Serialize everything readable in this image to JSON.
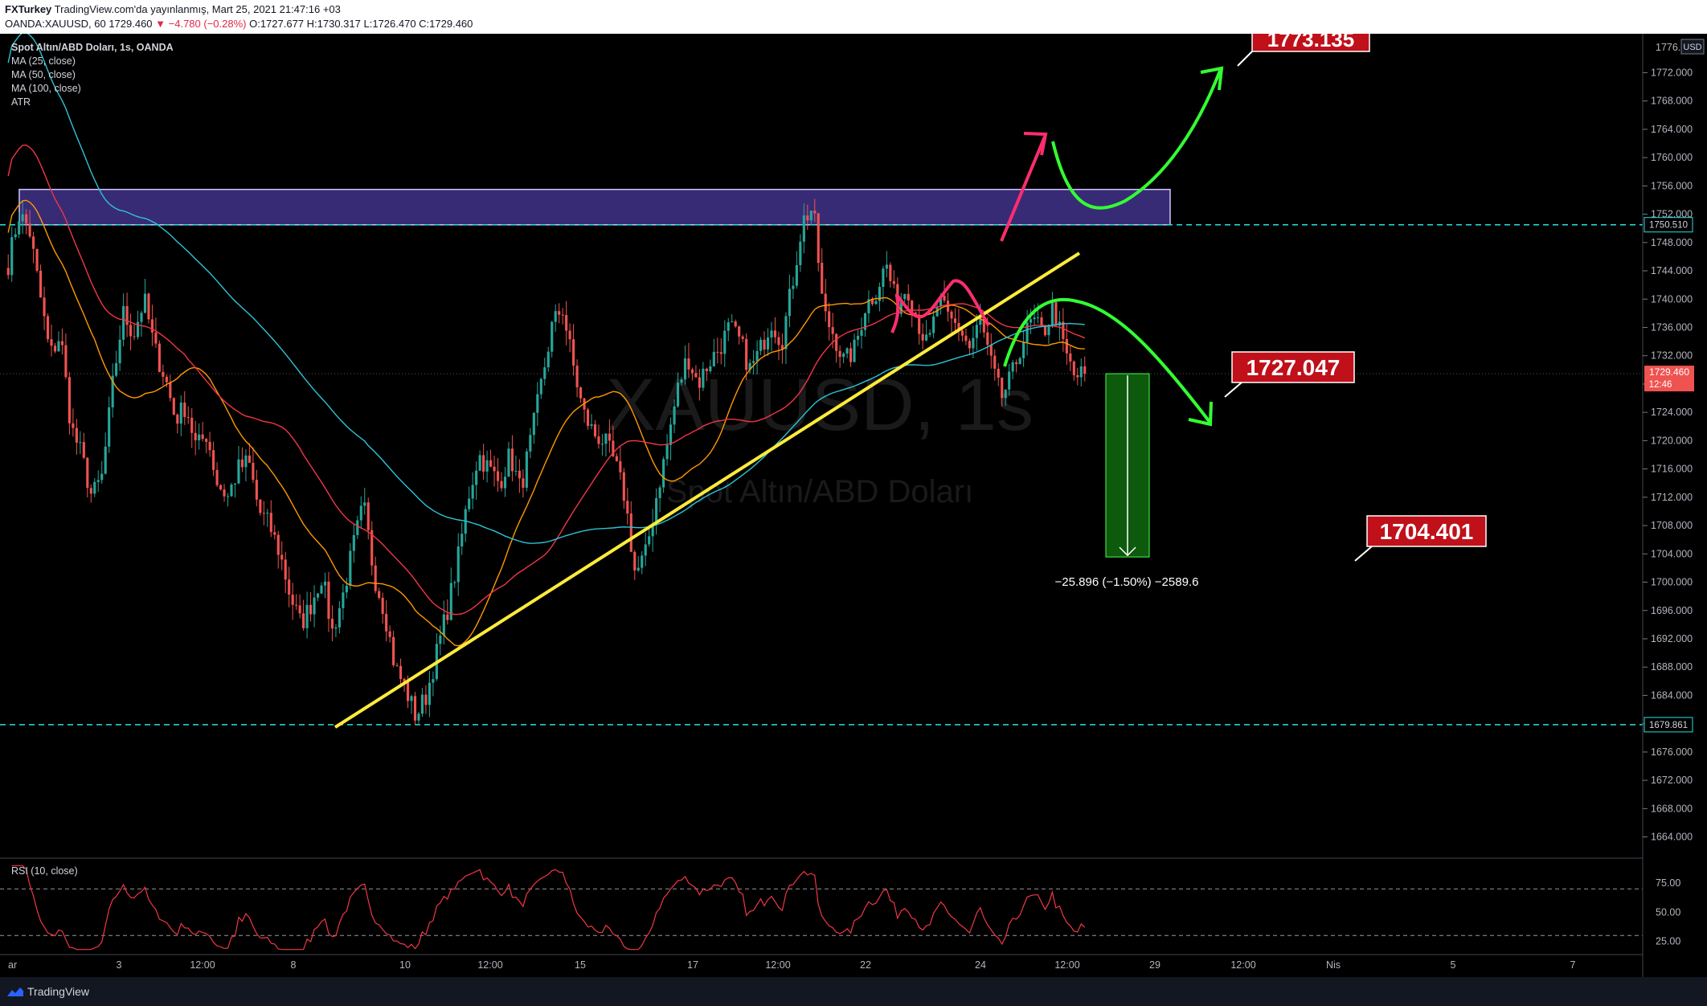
{
  "header": {
    "line1_user": "FXTurkey",
    "line1_rest": " TradingView.com'da yayınlanmış, Mart 25, 2021 21:47:16 +03",
    "line2_pre": "OANDA:XAUUSD, 60  1729.460 ",
    "line2_change": "▼ −4.780 (−0.28%)",
    "line2_ohlc": " O:1727.677  H:1730.317  L:1726.470  C:1729.460"
  },
  "legend": {
    "symbol": "Spot Altın/ABD Doları, 1s, OANDA",
    "ma25": "MA (25, close)",
    "ma50": "MA (50, close)",
    "ma100": "MA (100, close)",
    "atr": "ATR",
    "rsi": "RSI (10, close)"
  },
  "watermark": {
    "ticker": "XAUUSD, 1s",
    "name": "Spot Altın/ABD Doları"
  },
  "currency": "USD",
  "labels": {
    "target_up": "1773.135",
    "target_mid": "1727.047",
    "target_down": "1704.401",
    "measure": "−25.896 (−1.50%) −2589.6",
    "last_price": "1729.460",
    "countdown": "12:46",
    "resistance_price": "1750.510",
    "support_price": "1679.861",
    "top_clip": "1776.000"
  },
  "footer": {
    "brand": "TradingView"
  },
  "colors": {
    "up_candle": "#26a69a",
    "down_candle": "#ef5350",
    "ma25": "#ff9800",
    "ma50": "#f23645",
    "ma100": "#2ec4d6",
    "trendline": "#ffeb3b",
    "zone": "#6a4fc7",
    "dashed": "#26e0e0",
    "green_arrow": "#33ff33",
    "pink_arrow": "#ff2d6e",
    "label_bg": "#c0101a"
  },
  "chart_data": {
    "type": "candlestick",
    "symbol": "OANDA:XAUUSD",
    "timeframe": "1h",
    "y_axis_ticks": [
      "1772.000",
      "1768.000",
      "1764.000",
      "1760.000",
      "1756.000",
      "1752.000",
      "1748.000",
      "1744.000",
      "1740.000",
      "1736.000",
      "1732.000",
      "1728.000",
      "1724.000",
      "1720.000",
      "1716.000",
      "1712.000",
      "1708.000",
      "1704.000",
      "1700.000",
      "1696.000",
      "1692.000",
      "1688.000",
      "1684.000",
      "1680.000",
      "1676.000",
      "1672.000",
      "1668.000",
      "1664.000"
    ],
    "y_tick_values": [
      1772,
      1768,
      1764,
      1760,
      1756,
      1752,
      1748,
      1744,
      1740,
      1736,
      1732,
      1728,
      1724,
      1720,
      1716,
      1712,
      1708,
      1704,
      1700,
      1696,
      1692,
      1688,
      1684,
      1680,
      1676,
      1672,
      1668,
      1664
    ],
    "ylim": [
      1661.0,
      1777.5
    ],
    "x_axis_ticks": [
      "ar",
      "3",
      "12:00",
      "8",
      "10",
      "12:00",
      "15",
      "17",
      "12:00",
      "22",
      "24",
      "12:00",
      "29",
      "12:00",
      "Nis",
      "5",
      "7"
    ],
    "rsi_ticks": [
      "75.00",
      "50.00",
      "25.00"
    ],
    "rsi_levels": [
      70,
      30
    ],
    "rsi_range": [
      15,
      95
    ],
    "resistance_zone": [
      1750.5,
      1755.5
    ],
    "support_level": 1679.861,
    "resistance_level": 1750.51,
    "trendline": {
      "from": 1679.5,
      "to": 1746.5
    },
    "measure": {
      "from": 1729.46,
      "to": 1703.564,
      "change": -25.896,
      "percent": -1.5,
      "pips": -2589.6
    },
    "price_path": [
      1745,
      1752,
      1750,
      1741,
      1732,
      1735,
      1722,
      1718,
      1712,
      1715,
      1728,
      1738,
      1735,
      1740,
      1733,
      1729,
      1723,
      1725,
      1719,
      1721,
      1714,
      1712,
      1716,
      1717,
      1710,
      1708,
      1704,
      1698,
      1694,
      1697,
      1701,
      1693,
      1698,
      1705,
      1711,
      1701,
      1696,
      1688,
      1685,
      1681,
      1684,
      1690,
      1696,
      1703,
      1712,
      1718,
      1716,
      1714,
      1718,
      1713,
      1720,
      1728,
      1736,
      1739,
      1731,
      1724,
      1721,
      1720,
      1717,
      1712,
      1701,
      1704,
      1712,
      1719,
      1727,
      1732,
      1728,
      1731,
      1733,
      1736,
      1734,
      1730,
      1733,
      1737,
      1734,
      1742,
      1751,
      1753,
      1738,
      1735,
      1731,
      1733,
      1739,
      1741,
      1745,
      1739,
      1742,
      1737,
      1733,
      1740,
      1737,
      1736,
      1733,
      1737,
      1731,
      1726,
      1729,
      1734,
      1737,
      1735,
      1739,
      1733,
      1729,
      1729.46
    ]
  }
}
